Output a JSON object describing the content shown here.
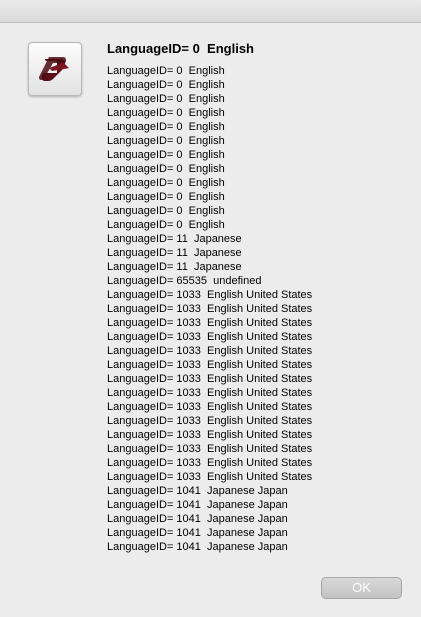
{
  "dialog": {
    "icon": "script-scroll-icon",
    "heading": "LanguageID= 0  English",
    "lines": [
      "LanguageID= 0  English",
      "LanguageID= 0  English",
      "LanguageID= 0  English",
      "LanguageID= 0  English",
      "LanguageID= 0  English",
      "LanguageID= 0  English",
      "LanguageID= 0  English",
      "LanguageID= 0  English",
      "LanguageID= 0  English",
      "LanguageID= 0  English",
      "LanguageID= 0  English",
      "LanguageID= 0  English",
      "LanguageID= 11  Japanese",
      "LanguageID= 11  Japanese",
      "LanguageID= 11  Japanese",
      "LanguageID= 65535  undefined",
      "LanguageID= 1033  English United States",
      "LanguageID= 1033  English United States",
      "LanguageID= 1033  English United States",
      "LanguageID= 1033  English United States",
      "LanguageID= 1033  English United States",
      "LanguageID= 1033  English United States",
      "LanguageID= 1033  English United States",
      "LanguageID= 1033  English United States",
      "LanguageID= 1033  English United States",
      "LanguageID= 1033  English United States",
      "LanguageID= 1033  English United States",
      "LanguageID= 1033  English United States",
      "LanguageID= 1033  English United States",
      "LanguageID= 1033  English United States",
      "LanguageID= 1041  Japanese Japan",
      "LanguageID= 1041  Japanese Japan",
      "LanguageID= 1041  Japanese Japan",
      "LanguageID= 1041  Japanese Japan",
      "LanguageID= 1041  Japanese Japan"
    ],
    "ok_label": "OK"
  },
  "colors": {
    "background": "#ececec",
    "icon_accent": "#5a0d16",
    "button_fill": "#cfcfcf",
    "button_text": "#fdfdfd"
  }
}
